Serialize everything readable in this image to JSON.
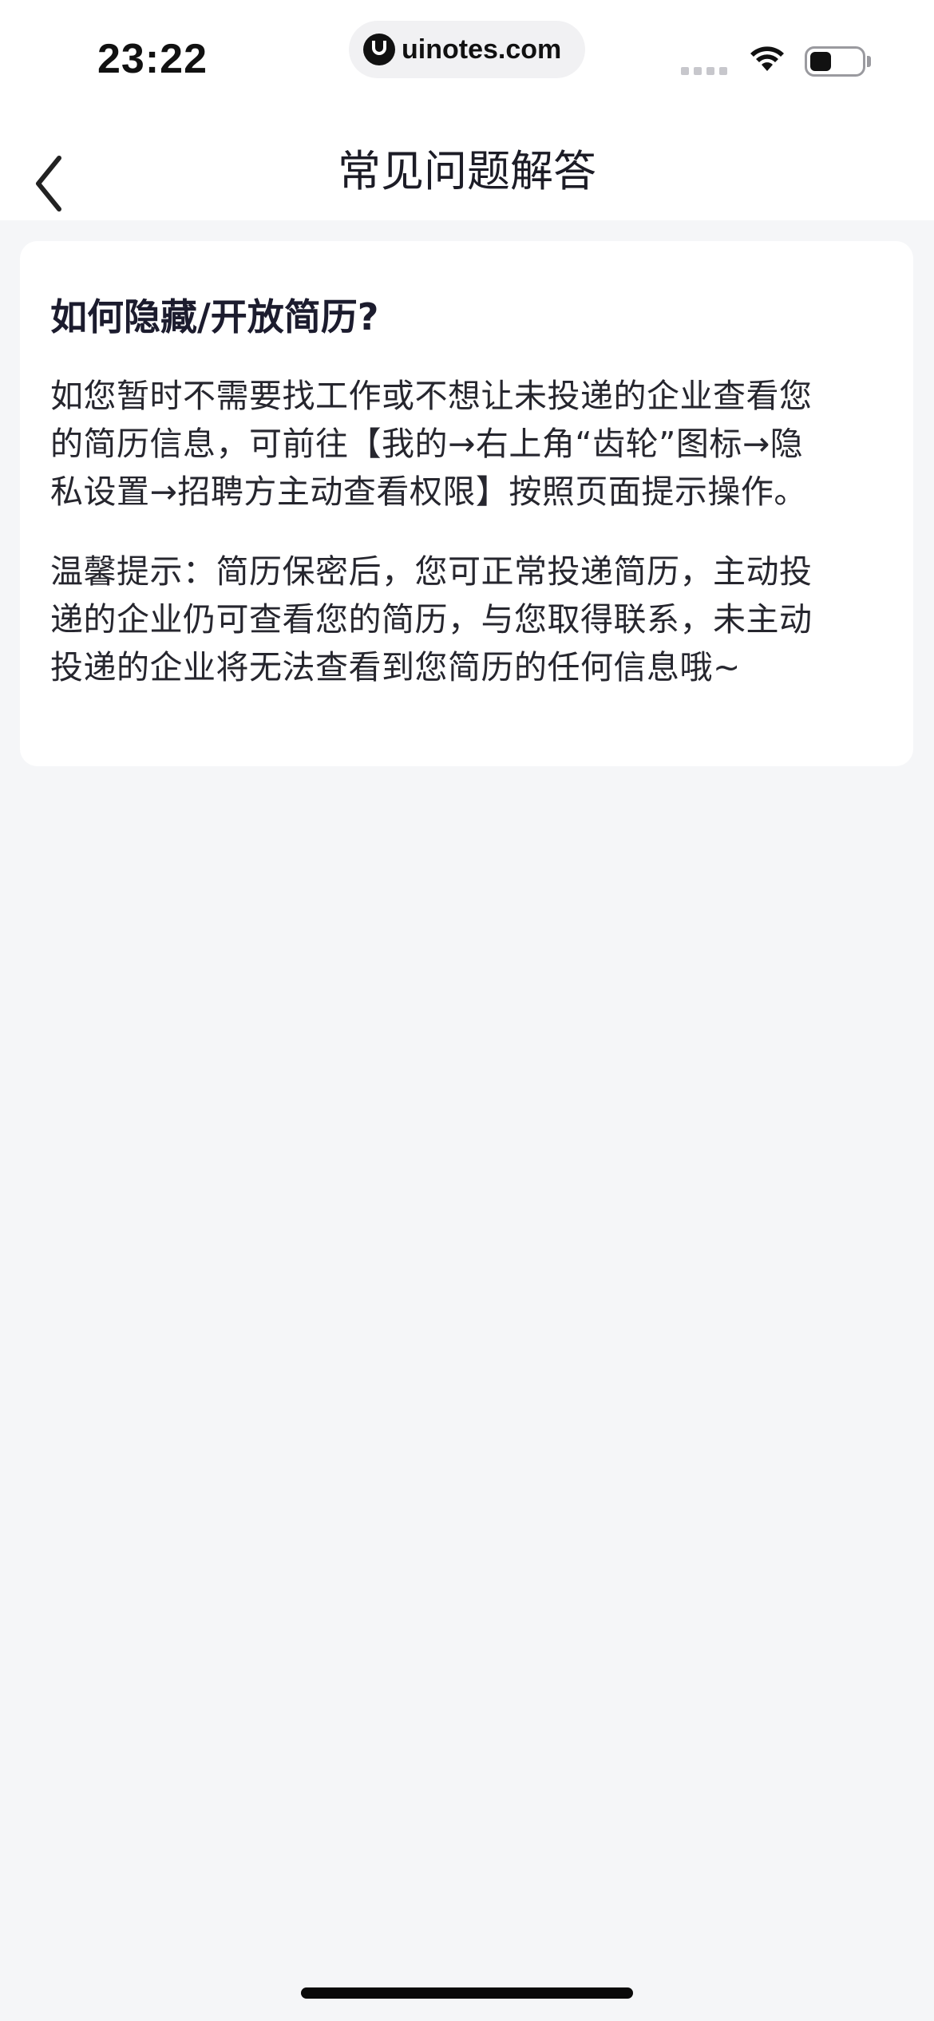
{
  "status_bar": {
    "time": "23:22",
    "url": "uinotes.com",
    "icons": [
      "signal-icon",
      "wifi-icon",
      "battery-icon"
    ]
  },
  "nav": {
    "back_icon": "chevron-left-icon",
    "title": "常见问题解答"
  },
  "faq": {
    "question": "如何隐藏/开放简历?",
    "answer": "如您暂时不需要找工作或不想让未投递的企业查看您\n的简历信息，可前往【我的→右上角“齿轮”图标→隐\n私设置→招聘方主动查看权限】按照页面提示操作。",
    "tip": "温馨提示：简历保密后，您可正常投递简历，主动投\n递的企业仍可查看您的简历，与您取得联系，未主动\n投递的企业将无法查看到您简历的任何信息哦~"
  },
  "colors": {
    "background": "#f5f6f8",
    "card": "#ffffff",
    "text_primary": "#1c1c2e"
  }
}
